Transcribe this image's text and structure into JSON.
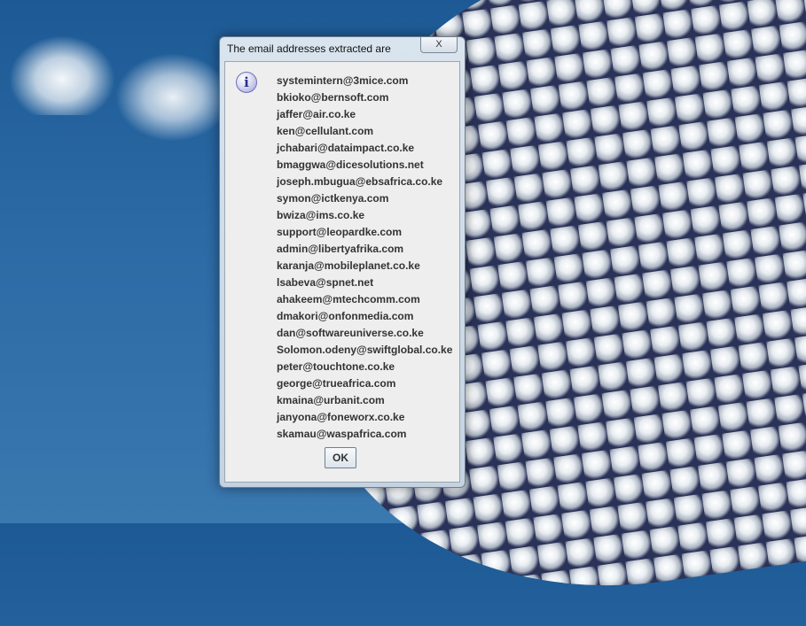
{
  "dialog": {
    "title": "The email addresses extracted are",
    "close_label": "X",
    "ok_label": "OK",
    "icon": "info-icon",
    "icon_glyph": "i",
    "emails": [
      "systemintern@3mice.com",
      "bkioko@bernsoft.com",
      "jaffer@air.co.ke",
      "ken@cellulant.com",
      "jchabari@dataimpact.co.ke",
      "bmaggwa@dicesolutions.net",
      "joseph.mbugua@ebsafrica.co.ke",
      "symon@ictkenya.com",
      "bwiza@ims.co.ke",
      "support@leopardke.com",
      "admin@libertyafrika.com",
      "karanja@mobileplanet.co.ke",
      "lsabeva@spnet.net",
      "ahakeem@mtechcomm.com",
      "dmakori@onfonmedia.com",
      "dan@softwareuniverse.co.ke",
      "Solomon.odeny@swiftglobal.co.ke",
      "peter@touchtone.co.ke",
      "george@trueafrica.com",
      "kmaina@urbanit.com",
      "janyona@foneworx.co.ke",
      "skamau@waspafrica.com"
    ]
  }
}
